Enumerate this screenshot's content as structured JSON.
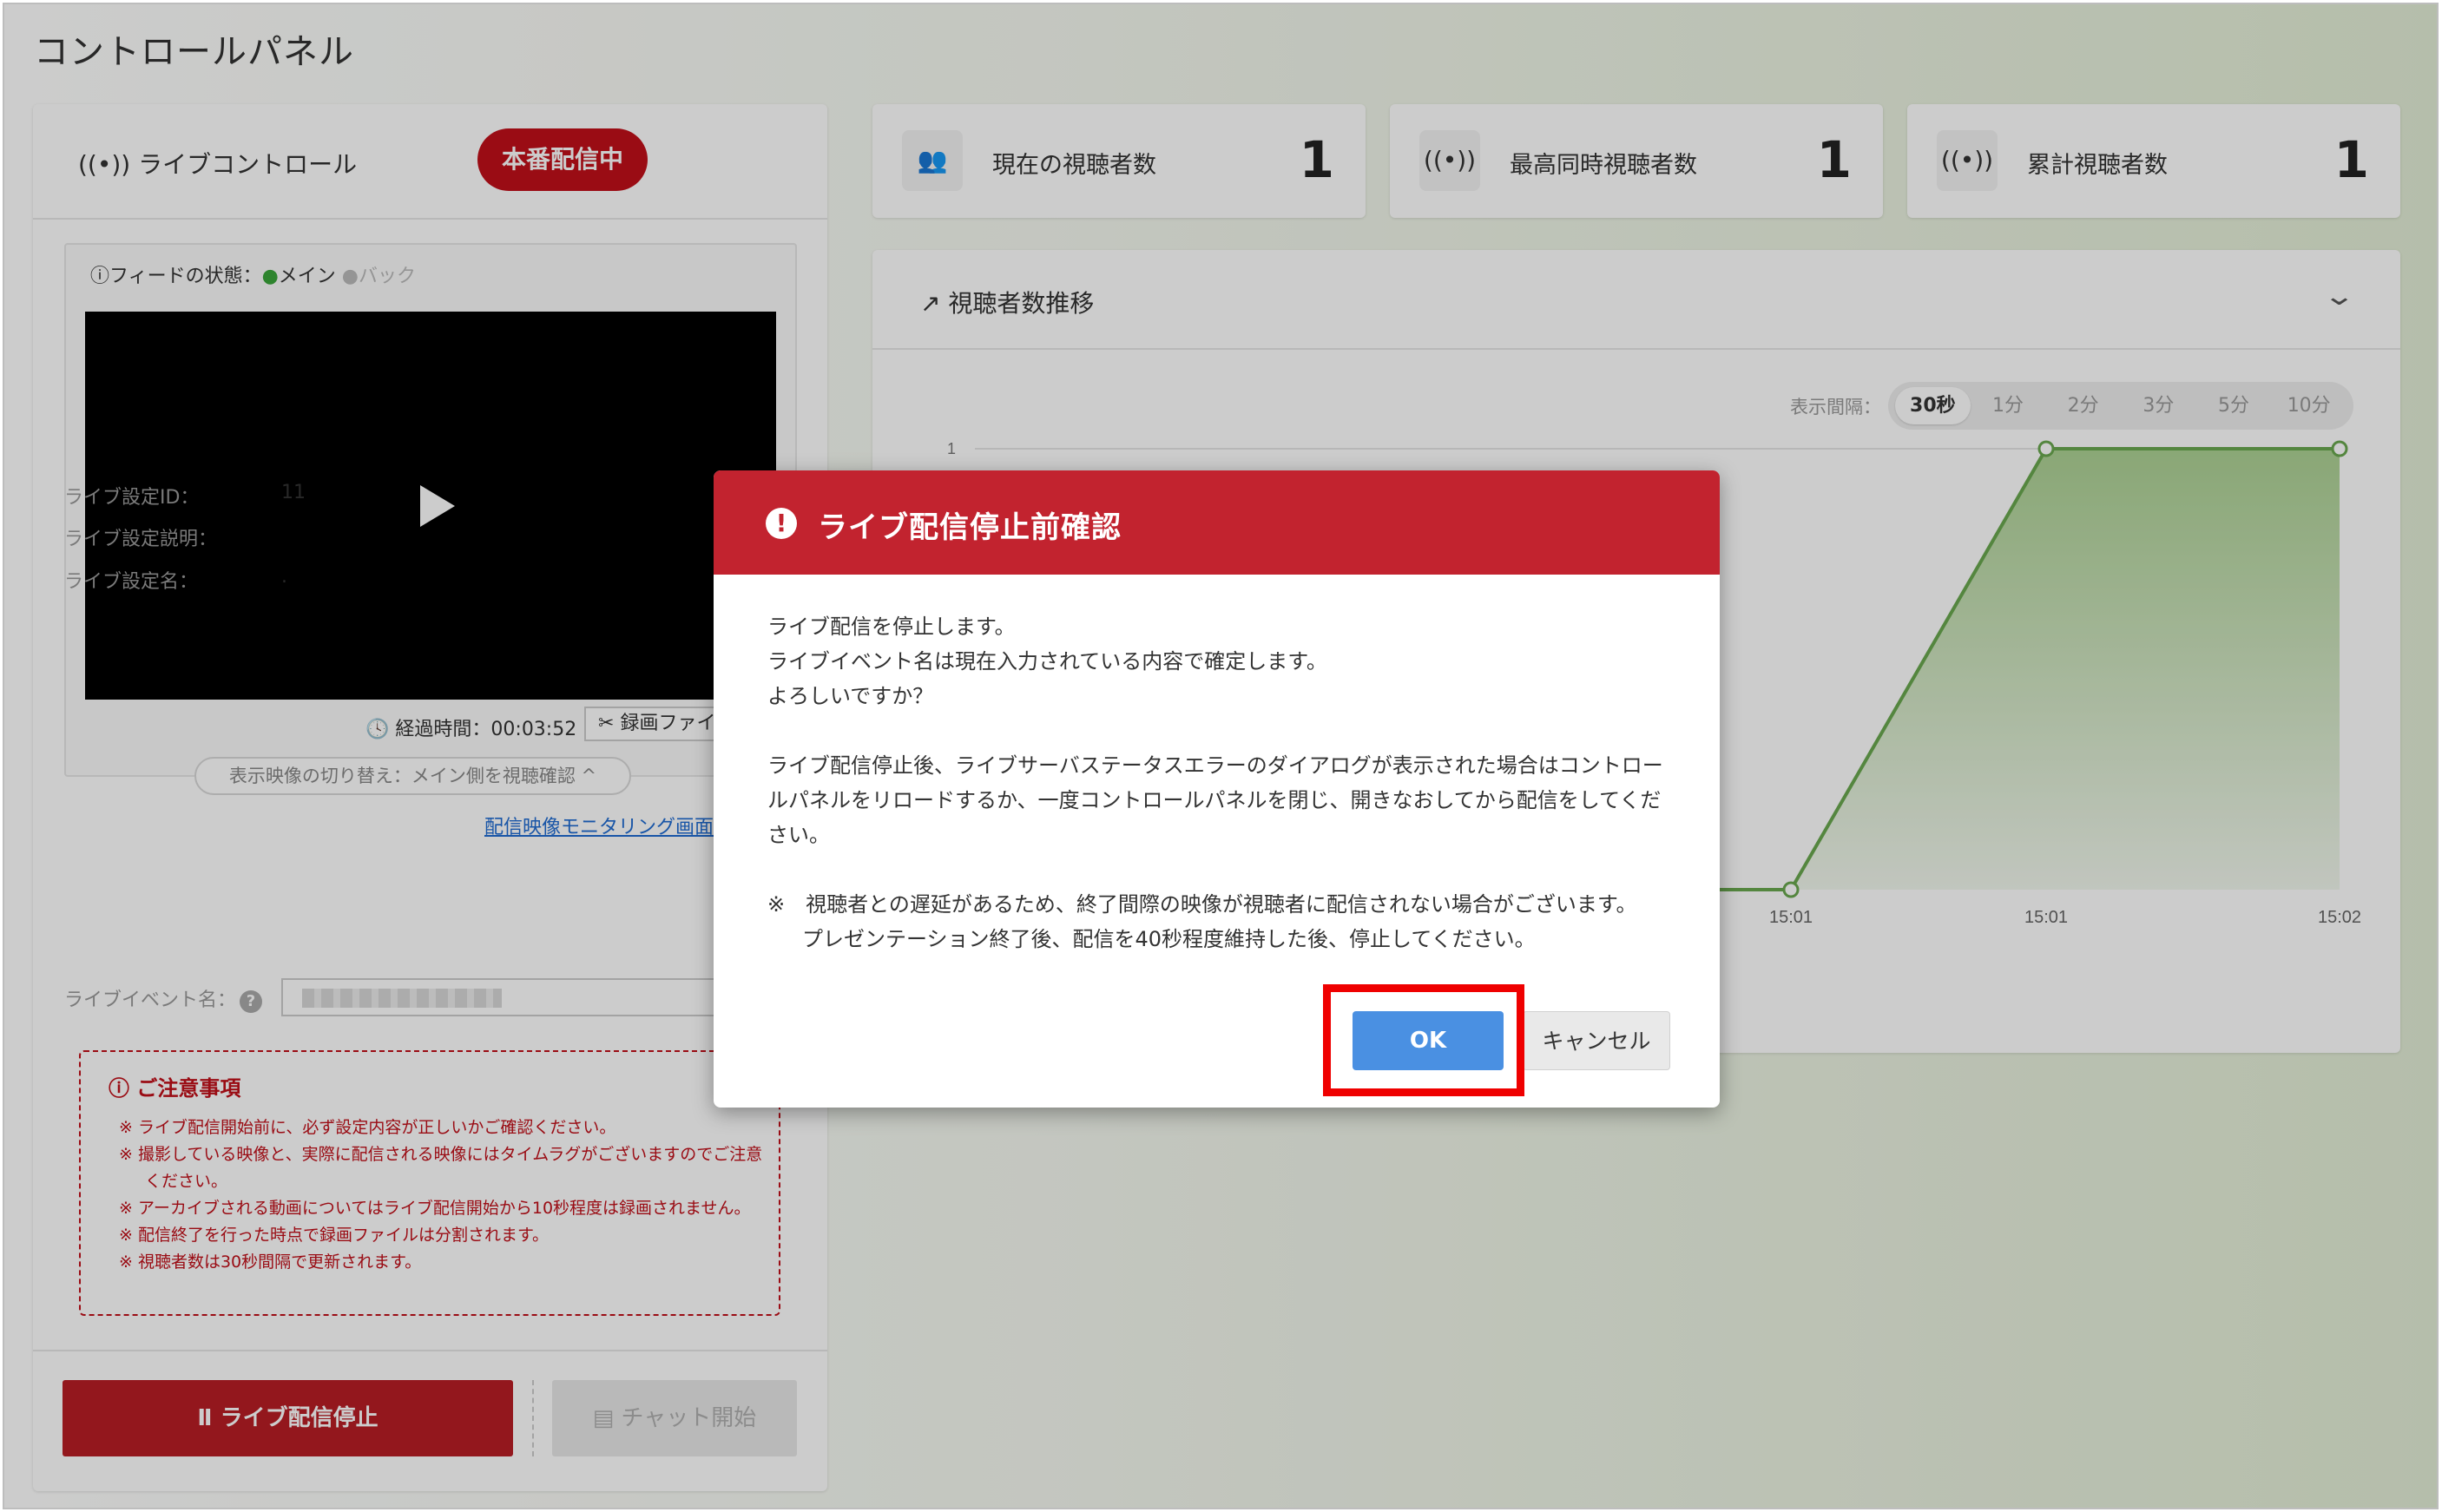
{
  "page": {
    "title": "コントロールパネル"
  },
  "live_control": {
    "title": "ライブコントロール",
    "status_badge": "本番配信中",
    "feed_status_label": "フィードの状態：",
    "feed_main": "メイン",
    "feed_backup": "バック",
    "elapsed_label": "経過時間：00:03:52",
    "record_file_button": "録画ファイル",
    "switch_view": "表示映像の切り替え：メイン側を視聴確認",
    "monitor_link": "配信映像モニタリング画面",
    "settings": {
      "id_label": "ライブ設定ID：",
      "id_value": "11",
      "description_label": "ライブ設定説明：",
      "name_label": "ライブ設定名：",
      "name_value": ".",
      "event_name_label": "ライブイベント名："
    },
    "notice": {
      "title": "ご注意事項",
      "items": [
        "※ ライブ配信開始前に、必ず設定内容が正しいかご確認ください。",
        "※ 撮影している映像と、実際に配信される映像にはタイムラグがございますのでご注意ください。",
        "※ アーカイブされる動画についてはライブ配信開始から10秒程度は録画されません。",
        "※ 配信終了を行った時点で録画ファイルは分割されます。",
        "※ 視聴者数は30秒間隔で更新されます。"
      ]
    },
    "stop_button": "ライブ配信停止",
    "chat_button": "チャット開始"
  },
  "stats": [
    {
      "icon": "people-icon",
      "label": "現在の視聴者数",
      "value": "1"
    },
    {
      "icon": "broadcast-icon",
      "label": "最高同時視聴者数",
      "value": "1"
    },
    {
      "icon": "broadcast-icon",
      "label": "累計視聴者数",
      "value": "1"
    }
  ],
  "chart": {
    "title": "視聴者数推移",
    "interval_label": "表示間隔：",
    "intervals": [
      "30秒",
      "1分",
      "2分",
      "3分",
      "5分",
      "10分"
    ],
    "active_interval": "30秒"
  },
  "chart_data": {
    "type": "area",
    "x": [
      "",
      "15:01",
      "15:01",
      "15:02"
    ],
    "values": [
      0,
      0,
      1,
      1
    ],
    "ylim": [
      0,
      1
    ],
    "yticks": [
      "1"
    ],
    "line_color": "#6aa84f",
    "fill_color": "#a8cf8e"
  },
  "modal": {
    "title": "ライブ配信停止前確認",
    "line1": "ライブ配信を停止します。",
    "line2": "ライブイベント名は現在入力されている内容で確定します。",
    "line3": "よろしいですか？",
    "para2": "ライブ配信停止後、ライブサーバステータスエラーのダイアログが表示された場合はコントロールパネルをリロードするか、一度コントロールパネルを閉じ、開きなおしてから配信をしてください。",
    "note1": "※　視聴者との遅延があるため、終了間際の映像が視聴者に配信されない場合がございます。",
    "note2": "プレゼンテーション終了後、配信を40秒程度維持した後、停止してください。",
    "ok": "OK",
    "cancel": "キャンセル"
  },
  "colors": {
    "live_red": "#c1101a",
    "modal_header": "#c2232f",
    "ok_blue": "#4a90e2",
    "highlight": "#ef0000"
  }
}
